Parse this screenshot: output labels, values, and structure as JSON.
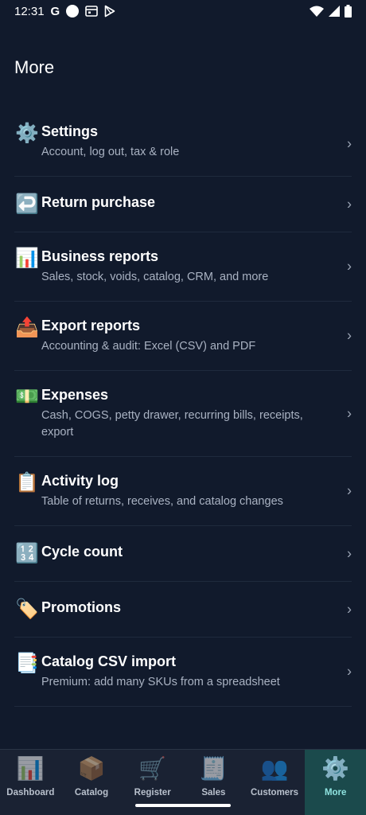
{
  "status_bar": {
    "time": "12:31",
    "g": "G"
  },
  "page_title": "More",
  "menu": [
    {
      "icon": "⚙️",
      "icon_name": "gear-icon",
      "label": "Settings",
      "subtitle": "Account, log out, tax & role"
    },
    {
      "icon": "↩️",
      "icon_name": "return-arrow-icon",
      "label": "Return purchase",
      "subtitle": ""
    },
    {
      "icon": "📊",
      "icon_name": "bar-chart-icon",
      "label": "Business reports",
      "subtitle": "Sales, stock, voids, catalog, CRM, and more"
    },
    {
      "icon": "📤",
      "icon_name": "outbox-tray-icon",
      "label": "Export reports",
      "subtitle": "Accounting & audit: Excel (CSV) and PDF"
    },
    {
      "icon": "💵",
      "icon_name": "cash-icon",
      "label": "Expenses",
      "subtitle": "Cash, COGS, petty drawer, recurring bills, receipts, export"
    },
    {
      "icon": "📋",
      "icon_name": "clipboard-icon",
      "label": "Activity log",
      "subtitle": "Table of returns, receives, and catalog changes"
    },
    {
      "icon": "🔢",
      "icon_name": "numbers-icon",
      "label": "Cycle count",
      "subtitle": ""
    },
    {
      "icon": "🏷️",
      "icon_name": "tag-icon",
      "label": "Promotions",
      "subtitle": ""
    },
    {
      "icon": "📑",
      "icon_name": "document-tabs-icon",
      "label": "Catalog CSV import",
      "subtitle": "Premium: add many SKUs from a spreadsheet"
    }
  ],
  "chevron": "›",
  "bottom_nav": [
    {
      "icon": "📊",
      "icon_name": "dashboard-icon",
      "label": "Dashboard",
      "active": false
    },
    {
      "icon": "📦",
      "icon_name": "catalog-box-icon",
      "label": "Catalog",
      "active": false
    },
    {
      "icon": "🛒",
      "icon_name": "register-cart-icon",
      "label": "Register",
      "active": false
    },
    {
      "icon": "🧾",
      "icon_name": "sales-receipt-icon",
      "label": "Sales",
      "active": false
    },
    {
      "icon": "👥",
      "icon_name": "customers-icon",
      "label": "Customers",
      "active": false
    },
    {
      "icon": "⚙️",
      "icon_name": "more-gear-icon",
      "label": "More",
      "active": true
    }
  ]
}
